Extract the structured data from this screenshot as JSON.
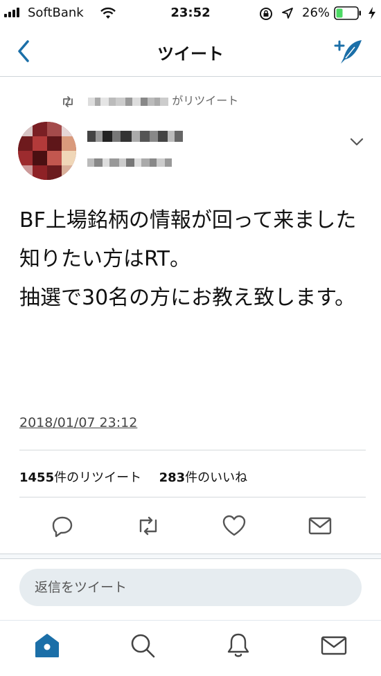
{
  "status_bar": {
    "carrier": "SoftBank",
    "time": "23:52",
    "battery_percent": "26%"
  },
  "nav": {
    "title": "ツイート"
  },
  "tweet": {
    "retweet_banner_suffix": "がリツイート",
    "lines": [
      "BF上場銘柄の情報が回って来ました",
      "知りたい方はRT。",
      "抽選で30名の方にお教え致します。"
    ],
    "timestamp": "2018/01/07 23:12"
  },
  "stats": {
    "retweets_count": "1455",
    "retweets_label": "件のリツイート",
    "likes_count": "283",
    "likes_label": "件のいいね"
  },
  "reply": {
    "placeholder": "返信をツイート"
  },
  "colors": {
    "accent": "#1b6fa8",
    "icon_gray": "#555555"
  }
}
